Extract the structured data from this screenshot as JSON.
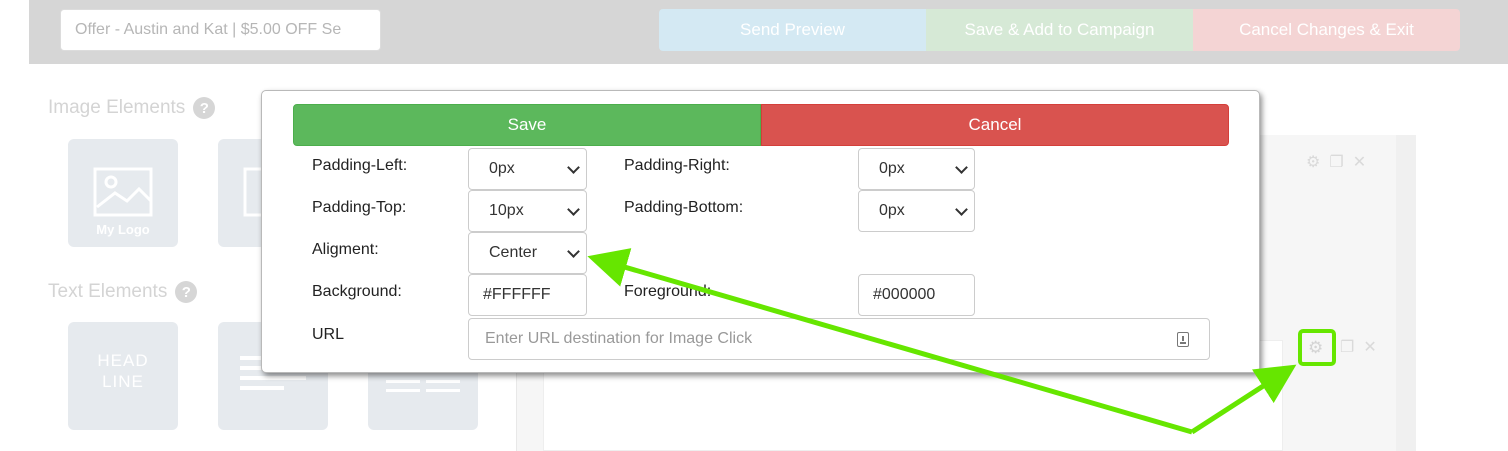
{
  "topbar": {
    "offer_value": "Offer - Austin and Kat | $5.00 OFF Se",
    "send_preview": "Send Preview",
    "save_add": "Save & Add to Campaign",
    "cancel_exit": "Cancel Changes & Exit"
  },
  "sidebar": {
    "image_title": "Image Elements",
    "text_title": "Text Elements",
    "help_glyph": "?",
    "my_logo": "My Logo",
    "headline_line1": "HEAD",
    "headline_line2": "LINE"
  },
  "modal": {
    "save": "Save",
    "cancel": "Cancel",
    "padding_left_label": "Padding-Left:",
    "padding_left_value": "0px",
    "padding_right_label": "Padding-Right:",
    "padding_right_value": "0px",
    "padding_top_label": "Padding-Top:",
    "padding_top_value": "10px",
    "padding_bottom_label": "Padding-Bottom:",
    "padding_bottom_value": "0px",
    "alignment_label": "Aligment:",
    "alignment_value": "Center",
    "background_label": "Background:",
    "background_value": "#FFFFFF",
    "foreground_label": "Foreground:",
    "foreground_value": "#000000",
    "url_label": "URL",
    "url_placeholder": "Enter URL destination for Image Click"
  },
  "colors": {
    "save_green": "#5cb85c",
    "cancel_red": "#d9534f",
    "annotation_green": "#66e600"
  },
  "icons": [
    "help-icon",
    "gear-icon",
    "copy-icon",
    "close-icon",
    "chevron-down-icon",
    "contact-card-icon",
    "image-icon",
    "text-lines-icon"
  ]
}
